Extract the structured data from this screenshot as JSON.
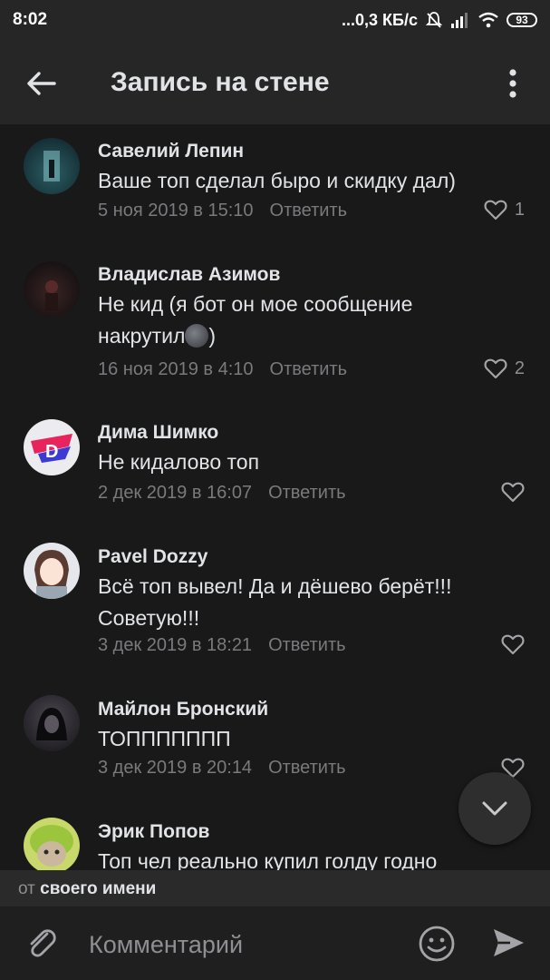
{
  "status_bar": {
    "time": "8:02",
    "network": "...0,3 КБ/с",
    "battery": "93"
  },
  "toolbar": {
    "title": "Запись на стене",
    "back_icon": "arrow-left-icon",
    "more_icon": "more-vertical-icon"
  },
  "comments": [
    {
      "author": "Савелий Лепин",
      "text": "Ваше топ сделал быро и скидку дал)",
      "date": "5 ноя 2019 в 15:10",
      "reply_label": "Ответить",
      "likes": "1",
      "avatar_color": "#3a6a70"
    },
    {
      "author": "Владислав Азимов",
      "text_before_emoji": "Не кид (я бот он мое сообщение накрутил",
      "text_after_emoji": ")",
      "emoji": "new-moon-face-emoji",
      "date": "16 ноя 2019 в 4:10",
      "reply_label": "Ответить",
      "likes": "2",
      "avatar_color": "#2a1e1e"
    },
    {
      "author": "Дима Шимко",
      "text": "Не кидалово топ",
      "date": "2 дек 2019 в 16:07",
      "reply_label": "Ответить",
      "likes": "",
      "avatar_color": "#e8e8ec"
    },
    {
      "author": "Pavel Dozzy",
      "text": "Всё топ вывел! Да и дёшево берёт!!! Советую!!!",
      "date": "3 дек 2019 в 18:21",
      "reply_label": "Ответить",
      "likes": "",
      "avatar_color": "#cfd6dc"
    },
    {
      "author": "Майлон Бронский",
      "text": "ТОППППППП",
      "date": "3 дек 2019 в 20:14",
      "reply_label": "Ответить",
      "likes": "",
      "avatar_color": "#2c2a2e"
    },
    {
      "author": "Эрик Попов",
      "text": "Топ чел реально купил голду годно",
      "avatar_color": "#c9d86a"
    }
  ],
  "from_bar": {
    "prefix": "от",
    "name": "своего имени"
  },
  "composer": {
    "placeholder": "Комментарий"
  },
  "colors": {
    "background": "#191919",
    "toolbar": "#262626",
    "text_primary": "#e1e3e6",
    "text_secondary": "#7a7a7d"
  }
}
